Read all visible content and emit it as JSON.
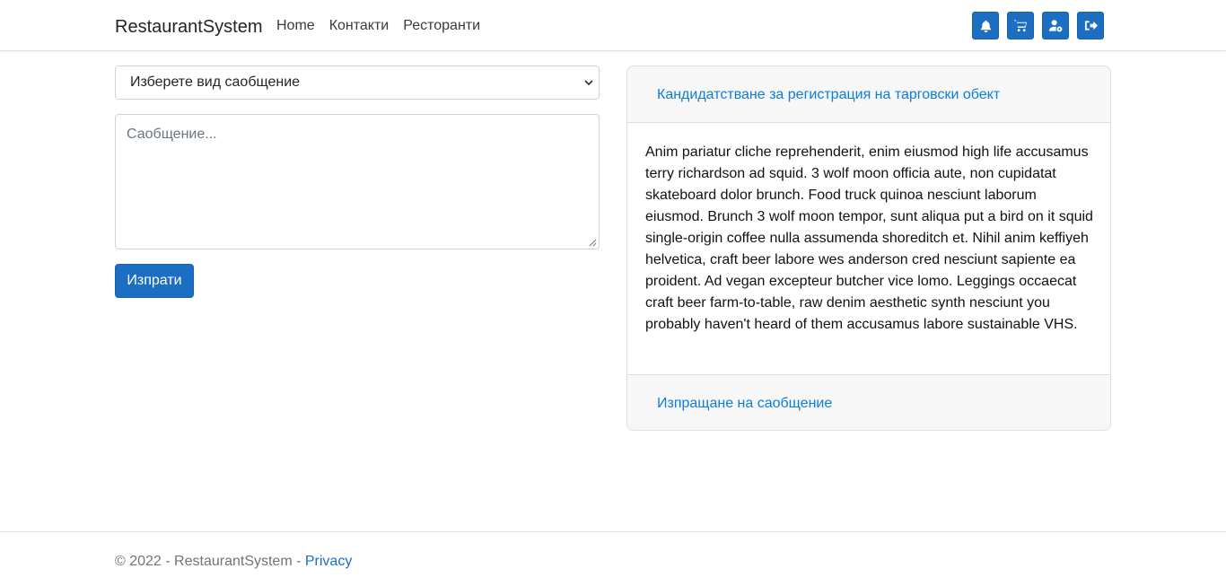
{
  "navbar": {
    "brand": "RestaurantSystem",
    "links": [
      "Home",
      "Контакти",
      "Ресторанти"
    ],
    "icons": [
      "bell-icon",
      "cart-icon",
      "user-cog-icon",
      "sign-out-icon"
    ]
  },
  "form": {
    "select_value": "Изберете вид саобщение",
    "message_placeholder": "Саобщение...",
    "submit_label": "Изпрати"
  },
  "accordion": {
    "item1_title": "Кандидатстване за регистрация на тарговски обект",
    "item1_body": "Anim pariatur cliche reprehenderit, enim eiusmod high life accusamus terry richardson ad squid. 3 wolf moon officia aute, non cupidatat skateboard dolor brunch. Food truck quinoa nesciunt laborum eiusmod. Brunch 3 wolf moon tempor, sunt aliqua put a bird on it squid single-origin coffee nulla assumenda shoreditch et. Nihil anim keffiyeh helvetica, craft beer labore wes anderson cred nesciunt sapiente ea proident. Ad vegan excepteur butcher vice lomo. Leggings occaecat craft beer farm-to-table, raw denim aesthetic synth nesciunt you probably haven't heard of them accusamus labore sustainable VHS.",
    "item2_title": "Изпращане на саобщение"
  },
  "footer": {
    "copyright": "© 2022 - RestaurantSystem - ",
    "privacy_link": "Privacy"
  },
  "colors": {
    "primary": "#1b6ec2",
    "accordion_link": "#0d7ddb",
    "muted": "#6c757d"
  }
}
